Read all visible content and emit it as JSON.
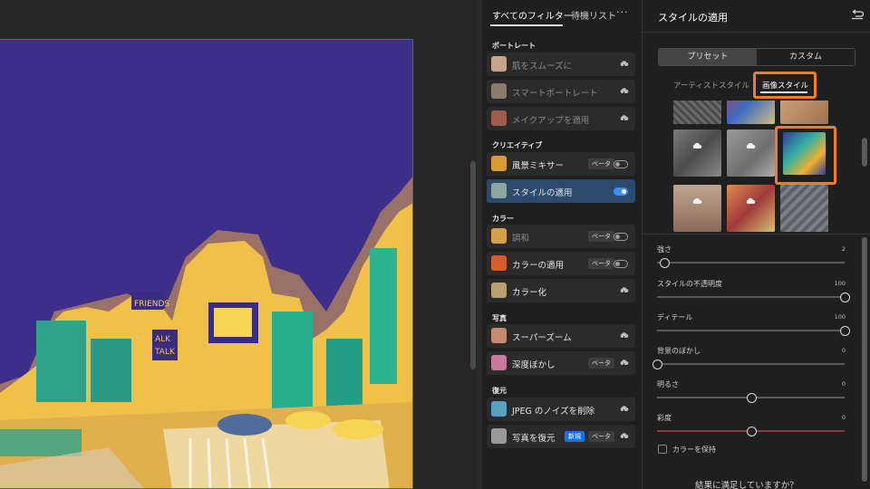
{
  "filters_panel": {
    "tabs": [
      {
        "label": "すべてのフィルター",
        "active": true
      },
      {
        "label": "待機リスト",
        "active": false
      }
    ],
    "more_icon": "more-icon",
    "sections": [
      {
        "title": "ポートレート",
        "items": [
          {
            "label": "肌をスムーズに",
            "dim": true,
            "trailing": "cloud-download-icon",
            "thumb_color": "#c9a48a"
          },
          {
            "label": "スマートポートレート",
            "dim": true,
            "trailing": "cloud-download-icon",
            "thumb_color": "#8c7a6a"
          },
          {
            "label": "メイクアップを適用",
            "dim": true,
            "trailing": "cloud-download-icon",
            "thumb_color": "#a05c4a"
          }
        ]
      },
      {
        "title": "クリエイティブ",
        "items": [
          {
            "label": "風景ミキサー",
            "badge": "ベータ",
            "trailing": "toggle-off",
            "thumb_color": "#d99a3a"
          },
          {
            "label": "スタイルの適用",
            "selected": true,
            "trailing": "toggle-on",
            "thumb_color": "#8fa6a0"
          }
        ]
      },
      {
        "title": "カラー",
        "items": [
          {
            "label": "調和",
            "dim": true,
            "badge": "ベータ",
            "trailing": "toggle-off",
            "thumb_color": "#d9a04a"
          },
          {
            "label": "カラーの適用",
            "badge": "ベータ",
            "trailing": "toggle-off",
            "thumb_color": "#d95a2a"
          },
          {
            "label": "カラー化",
            "trailing": "cloud-download-icon",
            "thumb_color": "#b9a070"
          }
        ]
      },
      {
        "title": "写真",
        "items": [
          {
            "label": "スーパーズーム",
            "trailing": "cloud-download-icon",
            "thumb_color": "#c98a70"
          },
          {
            "label": "深度ぼかし",
            "badge": "ベータ",
            "trailing": "cloud-download-icon",
            "thumb_color": "#c97a9a"
          }
        ]
      },
      {
        "title": "復元",
        "items": [
          {
            "label": "JPEG のノイズを削除",
            "trailing": "cloud-download-icon",
            "thumb_color": "#5aa0c0"
          },
          {
            "label": "写真を復元",
            "badge_new": "新規",
            "badge": "ベータ",
            "trailing": "cloud-download-icon",
            "thumb_color": "#9a9a9a"
          }
        ]
      }
    ]
  },
  "style_panel": {
    "title": "スタイルの適用",
    "undo_icon": "undo-icon",
    "segments": [
      {
        "label": "プリセット",
        "active": true
      },
      {
        "label": "カスタム",
        "active": false
      }
    ],
    "subtabs": [
      {
        "label": "アーティストスタイル",
        "active": false
      },
      {
        "label": "画像スタイル",
        "active": true
      }
    ],
    "highlight_color": "#f07d22",
    "sliders": [
      {
        "label": "強さ",
        "value": "2",
        "fraction": 0.04,
        "red": false
      },
      {
        "label": "スタイルの不透明度",
        "value": "100",
        "fraction": 1.0,
        "red": false
      },
      {
        "label": "ディテール",
        "value": "100",
        "fraction": 1.0,
        "red": false
      },
      {
        "label": "背景のぼかし",
        "value": "0",
        "fraction": 0.0,
        "red": false
      },
      {
        "label": "明るさ",
        "value": "0",
        "fraction": 0.5,
        "red": false
      },
      {
        "label": "彩度",
        "value": "0",
        "fraction": 0.5,
        "red": true
      }
    ],
    "preserve_color": {
      "label": "カラーを保持",
      "checked": false
    },
    "footer_question": "結果に満足していますか？"
  },
  "accent_color": "#1473e6"
}
